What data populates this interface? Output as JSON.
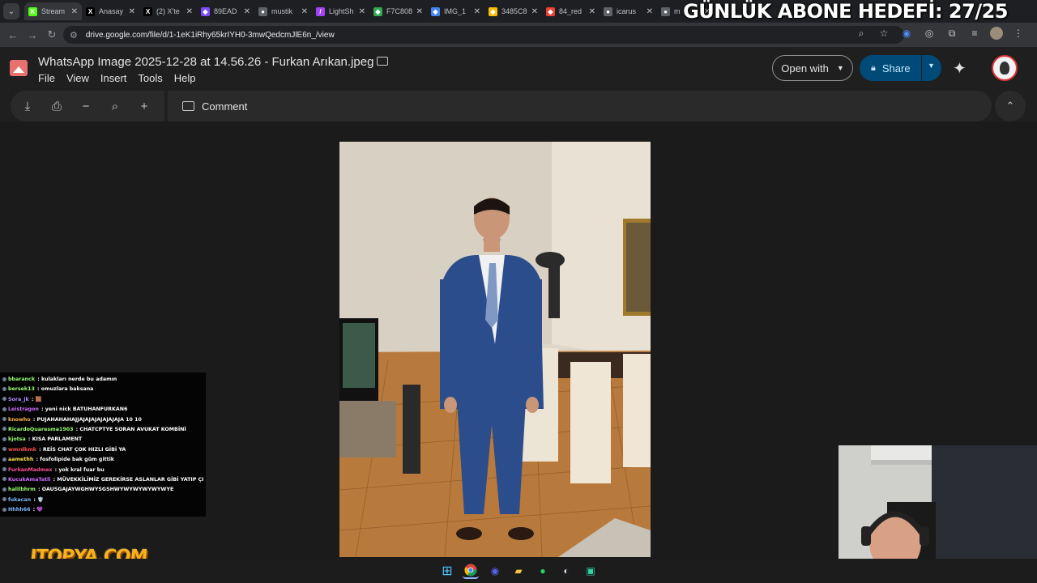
{
  "browser": {
    "tabs": [
      {
        "label": "Stream",
        "icon": "stream-icon",
        "color": "#53fc18",
        "glyph": "K"
      },
      {
        "label": "Anasay",
        "icon": "x-logo-icon",
        "color": "#000000",
        "glyph": "X"
      },
      {
        "label": "(2) X'te",
        "icon": "x-logo-icon",
        "color": "#000000",
        "glyph": "X"
      },
      {
        "label": "89EAD",
        "icon": "colorful-icon",
        "color": "#7c4dff",
        "glyph": "◆"
      },
      {
        "label": "mustik",
        "icon": "globe-icon",
        "color": "#5f6368",
        "glyph": "●"
      },
      {
        "label": "LightSh",
        "icon": "feather-icon",
        "color": "#a142f4",
        "glyph": "/"
      },
      {
        "label": "F7C808",
        "icon": "colorful-icon",
        "color": "#34a853",
        "glyph": "◆"
      },
      {
        "label": "IMG_1",
        "icon": "colorful-icon",
        "color": "#4285f4",
        "glyph": "◆"
      },
      {
        "label": "3485C8",
        "icon": "colorful-icon",
        "color": "#fbbc04",
        "glyph": "◆"
      },
      {
        "label": "84_red",
        "icon": "colorful-icon",
        "color": "#ea4335",
        "glyph": "◆"
      },
      {
        "label": "icarus",
        "icon": "globe-icon",
        "color": "#5f6368",
        "glyph": "●"
      },
      {
        "label": "m",
        "icon": "globe-icon",
        "color": "#5f6368",
        "glyph": "●"
      }
    ],
    "url": "drive.google.com/file/d/1-1eK1iRhy65krIYH0-3mwQedcmJlE6n_/view"
  },
  "overlay": {
    "goal_text": "GÜNLÜK ABONE HEDEFİ: 27/25",
    "sponsor_logo": "ITOPYA.COM"
  },
  "drive": {
    "file_title": "WhatsApp Image 2025-12-28 at 14.56.26 - Furkan Arıkan.jpeg",
    "menu": [
      "File",
      "View",
      "Insert",
      "Tools",
      "Help"
    ],
    "open_with_label": "Open with",
    "share_label": "Share",
    "comment_label": "Comment",
    "accent": "#004a77"
  },
  "chat": [
    {
      "user": "bbaranck",
      "color": "#9bff73",
      "msg": "kulakları nerde bu adamın"
    },
    {
      "user": "bersek13",
      "color": "#9bff73",
      "msg": "omuzlara baksana"
    },
    {
      "user": "Sora_jk",
      "color": "#b48cff",
      "msg": "🟫"
    },
    {
      "user": "Leistragon",
      "color": "#d06cff",
      "msg": "yeni nick BATUHANFURKAN6"
    },
    {
      "user": "knowho",
      "color": "#ffb347",
      "msg": "PUJAHAHAHAJJAJAJAJAJAJAJAJA 10 10"
    },
    {
      "user": "RicardoQuaresma1903",
      "color": "#9bff73",
      "msg": "CHATCPTYE SORAN AVUKAT KOMBİNİ"
    },
    {
      "user": "kjotsa",
      "color": "#9bff73",
      "msg": "KISA PARLAMENT"
    },
    {
      "user": "wmrdkmk",
      "color": "#ff4d4d",
      "msg": "REİS CHAT ÇOK HIZLI GİBİ YA"
    },
    {
      "user": "aamethh",
      "color": "#ffe14d",
      "msg": "fosfolipide bak gûm gittik"
    },
    {
      "user": "FurkanMadmex",
      "color": "#ff4d9a",
      "msg": "yok kral fuar bu"
    },
    {
      "user": "KucukAmaTatli",
      "color": "#d06cff",
      "msg": "MÜVEKKİLİMİZ GEREKİRSE ASLANLAR GİBİ YATIP ÇIKAR"
    },
    {
      "user": "halilbhrm",
      "color": "#9bff73",
      "msg": "OAUSGAJAYWGHWYSGSHWYWYWYWYWYWYE"
    },
    {
      "user": "fukacan",
      "color": "#7ab8ff",
      "msg": "🛡️"
    },
    {
      "user": "Hhhh66",
      "color": "#7ab8ff",
      "msg": "💜"
    }
  ]
}
